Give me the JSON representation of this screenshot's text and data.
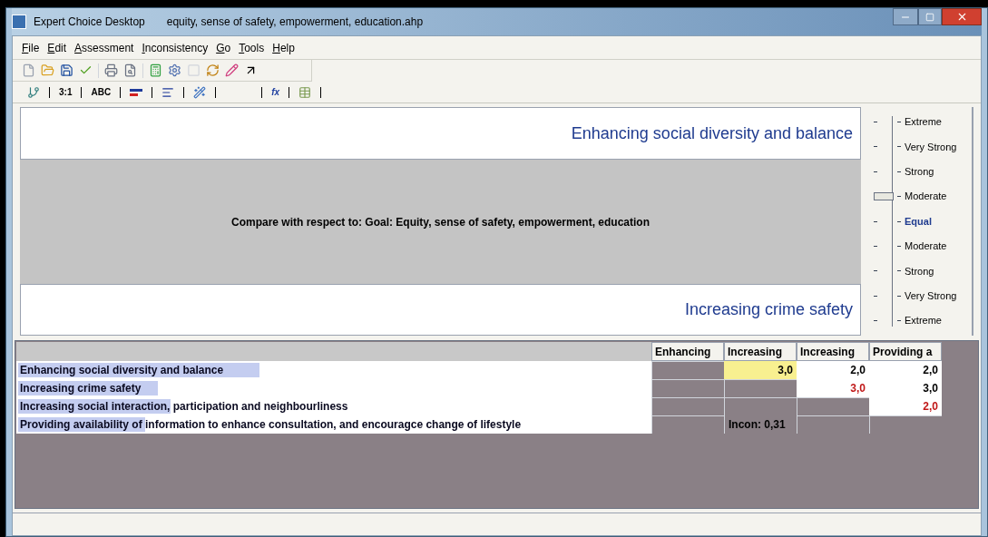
{
  "window": {
    "app": "Expert Choice Desktop",
    "file": "equity, sense of safety, empowerment, education.ahp"
  },
  "menu": [
    {
      "label": "File"
    },
    {
      "label": "Edit"
    },
    {
      "label": "Assessment"
    },
    {
      "label": "Inconsistency"
    },
    {
      "label": "Go"
    },
    {
      "label": "Tools"
    },
    {
      "label": "Help"
    }
  ],
  "view_tabs": [
    {
      "kind": "icon"
    },
    {
      "kind": "text",
      "label": "3:1"
    },
    {
      "kind": "text",
      "label": "ABC"
    },
    {
      "kind": "icon"
    },
    {
      "kind": "icon"
    },
    {
      "kind": "icon"
    },
    {
      "kind": "blank"
    },
    {
      "kind": "text",
      "label": "fx"
    },
    {
      "kind": "icon"
    }
  ],
  "comparison": {
    "top": "Enhancing social diversity and balance",
    "prompt": "Compare with respect to: Goal: Equity, sense of safety, empowerment, education",
    "bottom": "Increasing crime safety"
  },
  "scale": [
    {
      "label": "Extreme",
      "kind": "intensity",
      "selected": false
    },
    {
      "label": "Very Strong",
      "kind": "intensity",
      "selected": false
    },
    {
      "label": "Strong",
      "kind": "intensity",
      "selected": false
    },
    {
      "label": "Moderate",
      "kind": "intensity",
      "selected": true
    },
    {
      "label": "Equal",
      "kind": "equal",
      "selected": false
    },
    {
      "label": "Moderate",
      "kind": "intensity",
      "selected": false
    },
    {
      "label": "Strong",
      "kind": "intensity",
      "selected": false
    },
    {
      "label": "Very Strong",
      "kind": "intensity",
      "selected": false
    },
    {
      "label": "Extreme",
      "kind": "intensity",
      "selected": false
    }
  ],
  "matrix": {
    "columns": [
      "Enhancing",
      "Increasing",
      "Increasing",
      "Providing a"
    ],
    "rows": [
      {
        "label": "Enhancing social diversity and balance",
        "level": 0.38,
        "cells": [
          {
            "kind": "blank"
          },
          {
            "kind": "value",
            "text": "3,0",
            "selected": true,
            "inverted": false
          },
          {
            "kind": "value",
            "text": "2,0",
            "selected": false,
            "inverted": false
          },
          {
            "kind": "value",
            "text": "2,0",
            "selected": false,
            "inverted": false
          }
        ]
      },
      {
        "label": "Increasing crime safety",
        "level": 0.22,
        "cells": [
          {
            "kind": "blank"
          },
          {
            "kind": "blank"
          },
          {
            "kind": "value",
            "text": "3,0",
            "selected": false,
            "inverted": true
          },
          {
            "kind": "value",
            "text": "3,0",
            "selected": false,
            "inverted": false
          }
        ]
      },
      {
        "label": "Increasing social interaction, participation and neighbourliness",
        "level": 0.24,
        "cells": [
          {
            "kind": "blank"
          },
          {
            "kind": "blank"
          },
          {
            "kind": "blank"
          },
          {
            "kind": "value",
            "text": "2,0",
            "selected": false,
            "inverted": true
          }
        ]
      },
      {
        "label": "Providing availability of information to enhance consultation, and encouragce change of lifestyle",
        "level": 0.2,
        "cells": [
          {
            "kind": "blank"
          },
          {
            "kind": "incon",
            "text": "Incon: 0,31"
          },
          {
            "kind": "blank"
          },
          {
            "kind": "blank"
          }
        ]
      }
    ]
  }
}
